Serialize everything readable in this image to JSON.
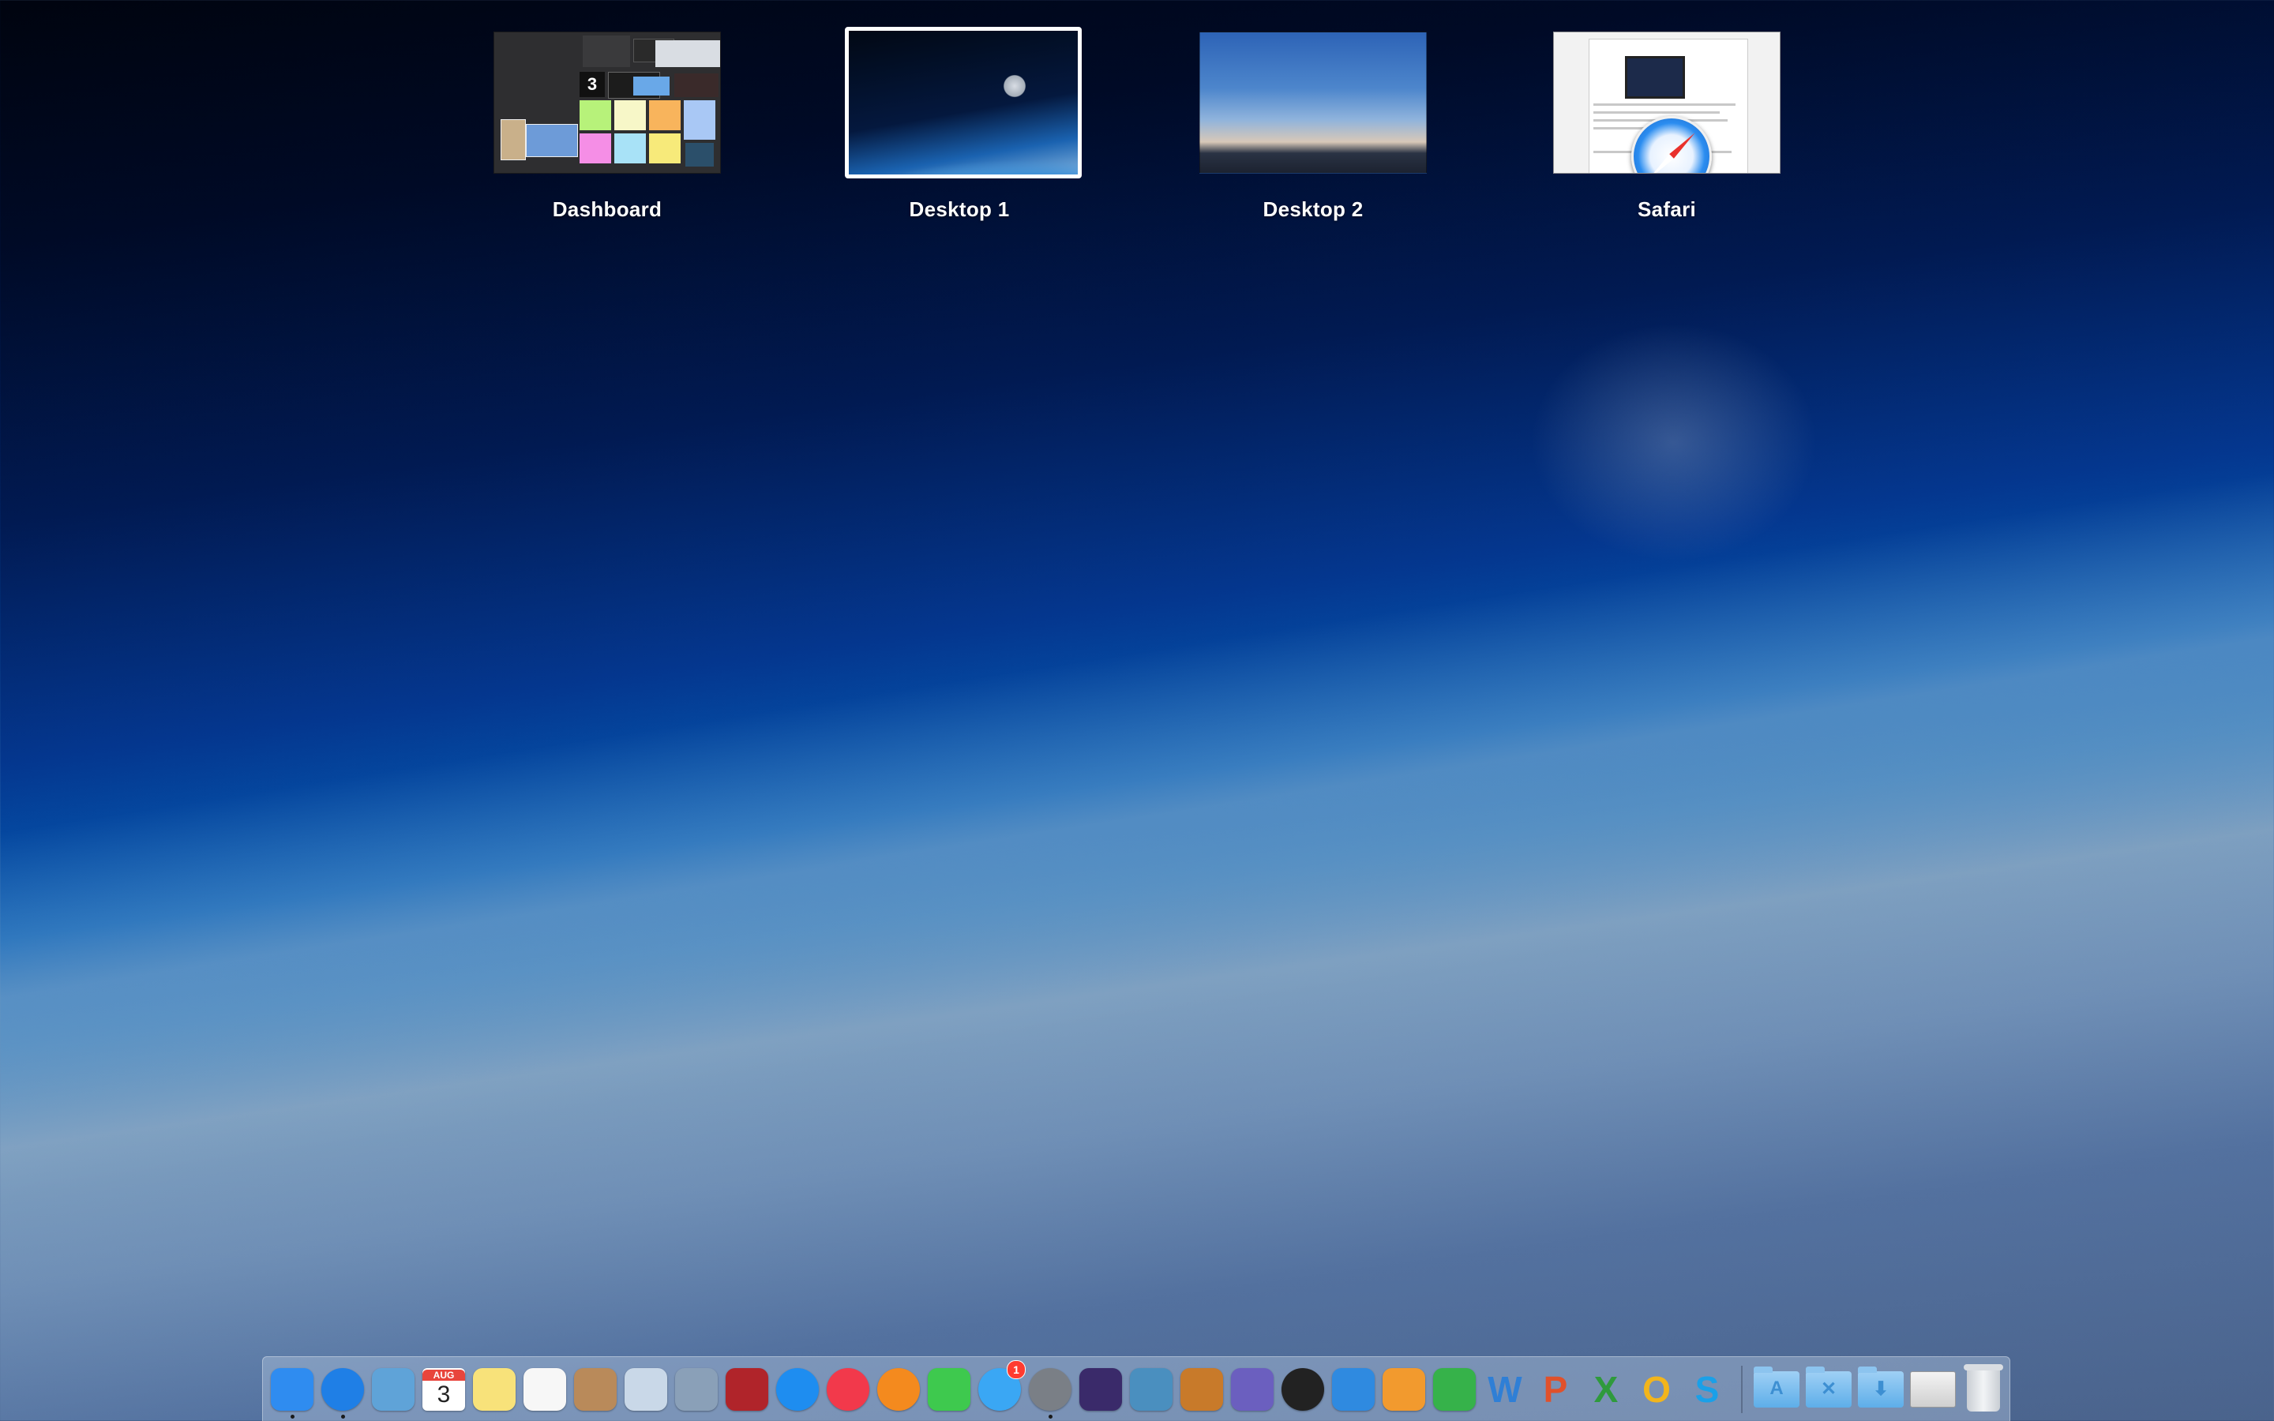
{
  "spaces": [
    {
      "label": "Dashboard",
      "thumb": "dashboard-widgets",
      "active": false
    },
    {
      "label": "Desktop 1",
      "thumb": "earth-orbit",
      "active": true
    },
    {
      "label": "Desktop 2",
      "thumb": "sky-clouds",
      "active": false
    },
    {
      "label": "Safari",
      "thumb": "safari-window",
      "active": false
    }
  ],
  "dashboard": {
    "calendar_day": "3"
  },
  "dock": {
    "apps": [
      {
        "name": "Finder",
        "icon": "finder-icon",
        "color": "#2f8cf0",
        "running": true
      },
      {
        "name": "Safari",
        "icon": "safari-icon",
        "color": "#1f7fe6",
        "running": true
      },
      {
        "name": "Mail",
        "icon": "mail-icon",
        "color": "#5fa3d8"
      },
      {
        "name": "Calendar",
        "icon": "calendar-icon",
        "color": "#ffffff",
        "month": "AUG",
        "day": "3"
      },
      {
        "name": "Notes",
        "icon": "notes-icon",
        "color": "#f8e27a"
      },
      {
        "name": "Reminders",
        "icon": "reminders-icon",
        "color": "#f7f7f7"
      },
      {
        "name": "Contacts",
        "icon": "contacts-icon",
        "color": "#b98a5a"
      },
      {
        "name": "Preview",
        "icon": "preview-icon",
        "color": "#c9d8e8"
      },
      {
        "name": "Image Capture",
        "icon": "image-capture-icon",
        "color": "#8aa0b8"
      },
      {
        "name": "Photo Booth",
        "icon": "photo-booth-icon",
        "color": "#b0242a"
      },
      {
        "name": "App Store",
        "icon": "app-store-icon",
        "color": "#1e8df0"
      },
      {
        "name": "iTunes",
        "icon": "itunes-icon",
        "color": "#f2394b"
      },
      {
        "name": "iBooks",
        "icon": "ibooks-icon",
        "color": "#f48a1e"
      },
      {
        "name": "FaceTime",
        "icon": "facetime-icon",
        "color": "#3ec94e"
      },
      {
        "name": "Messages",
        "icon": "messages-icon",
        "color": "#3aa7f4",
        "badge": "1"
      },
      {
        "name": "System Preferences",
        "icon": "system-preferences-icon",
        "color": "#7a7f86",
        "running": true
      },
      {
        "name": "iMovie",
        "icon": "imovie-icon",
        "color": "#3a2a6a"
      },
      {
        "name": "iPhoto",
        "icon": "iphoto-icon",
        "color": "#4a8fbf"
      },
      {
        "name": "GarageBand",
        "icon": "garageband-icon",
        "color": "#c87a2a"
      },
      {
        "name": "Motion",
        "icon": "motion-icon",
        "color": "#6b5fbf"
      },
      {
        "name": "Aperture",
        "icon": "aperture-icon",
        "color": "#222222"
      },
      {
        "name": "Keynote",
        "icon": "keynote-icon",
        "color": "#2f8ae0"
      },
      {
        "name": "Pages",
        "icon": "pages-icon",
        "color": "#f29a2e"
      },
      {
        "name": "Numbers",
        "icon": "numbers-icon",
        "color": "#36b24a"
      },
      {
        "name": "Word",
        "icon": "word-icon",
        "color": "#2f7fd6",
        "letter": "W"
      },
      {
        "name": "PowerPoint",
        "icon": "powerpoint-icon",
        "color": "#e0512b",
        "letter": "P"
      },
      {
        "name": "Excel",
        "icon": "excel-icon",
        "color": "#2f9a3c",
        "letter": "X"
      },
      {
        "name": "Outlook",
        "icon": "outlook-icon",
        "color": "#f2b51c",
        "letter": "O"
      },
      {
        "name": "Skype",
        "icon": "skype-icon",
        "color": "#1aa0e8",
        "letter": "S"
      }
    ],
    "folders": [
      {
        "name": "Applications",
        "icon": "applications-folder-icon",
        "glyph": "A"
      },
      {
        "name": "Utilities",
        "icon": "utilities-folder-icon",
        "glyph": "✕"
      },
      {
        "name": "Downloads",
        "icon": "downloads-folder-icon",
        "glyph": "⬇"
      }
    ],
    "extras": [
      {
        "name": "Documents stack",
        "icon": "documents-stack-icon"
      },
      {
        "name": "Trash",
        "icon": "trash-icon"
      }
    ]
  }
}
